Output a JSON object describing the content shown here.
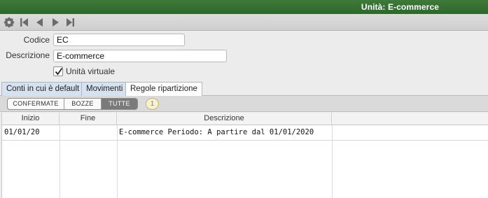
{
  "window": {
    "title": "Unità: E-commerce"
  },
  "toolbar": {
    "icons": [
      "gear-icon",
      "first-record-icon",
      "previous-record-icon",
      "next-record-icon",
      "last-record-icon"
    ]
  },
  "form": {
    "codice_label": "Codice",
    "codice_value": "EC",
    "descrizione_label": "Descrizione",
    "descrizione_value": "E-commerce",
    "unita_virtuale_label": "Unità virtuale",
    "unita_virtuale_checked": true
  },
  "tabs": [
    {
      "label": "Conti in cui è default",
      "active": false
    },
    {
      "label": "Movimenti",
      "active": false
    },
    {
      "label": "Regole ripartizione",
      "active": true
    }
  ],
  "filter": {
    "options": [
      {
        "label": "Confermate",
        "selected": false
      },
      {
        "label": "Bozze",
        "selected": false
      },
      {
        "label": "Tutte",
        "selected": true
      }
    ],
    "count": "1"
  },
  "table": {
    "columns": [
      "Inizio",
      "Fine",
      "Descrizione",
      ""
    ],
    "rows": [
      {
        "inizio": "01/01/20",
        "fine": "",
        "descrizione": "E-commerce Periodo: A partire dal 01/01/2020"
      }
    ]
  },
  "colors": {
    "titlebar": "#2e672b",
    "tab_inactive": "#d6e2ef",
    "badge": "#9a8430"
  }
}
